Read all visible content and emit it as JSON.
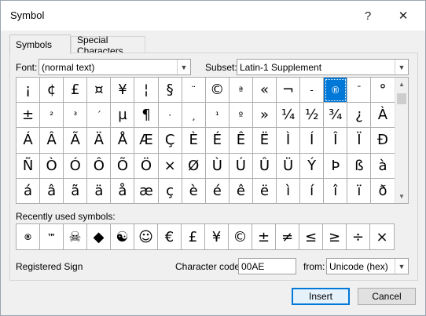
{
  "window": {
    "title": "Symbol",
    "help_label": "?",
    "close_label": "✕"
  },
  "tabs": [
    {
      "label": "Symbols",
      "active": true
    },
    {
      "label": "Special Characters",
      "active": false
    }
  ],
  "font": {
    "label": "Font:",
    "value": "(normal text)"
  },
  "subset": {
    "label": "Subset:",
    "value": "Latin-1 Supplement"
  },
  "symbol_grid": {
    "rows": [
      [
        "¡",
        "¢",
        "£",
        "¤",
        "¥",
        "¦",
        "§",
        "¨",
        "©",
        "ª",
        "«",
        "¬",
        "-",
        "®",
        "¯",
        "°"
      ],
      [
        "±",
        "²",
        "³",
        "´",
        "µ",
        "¶",
        "·",
        "¸",
        "¹",
        "º",
        "»",
        "¼",
        "½",
        "¾",
        "¿",
        "À"
      ],
      [
        "Á",
        "Â",
        "Ã",
        "Ä",
        "Å",
        "Æ",
        "Ç",
        "È",
        "É",
        "Ê",
        "Ë",
        "Ì",
        "Í",
        "Î",
        "Ï",
        "Đ"
      ],
      [
        "Ñ",
        "Ò",
        "Ó",
        "Ô",
        "Õ",
        "Ö",
        "×",
        "Ø",
        "Ù",
        "Ú",
        "Û",
        "Ü",
        "Ý",
        "Þ",
        "ß",
        "à"
      ],
      [
        "á",
        "â",
        "ã",
        "ä",
        "å",
        "æ",
        "ç",
        "è",
        "é",
        "ê",
        "ë",
        "ì",
        "í",
        "î",
        "ï",
        "ð"
      ]
    ],
    "selected": "®"
  },
  "recent": {
    "label": "Recently used symbols:",
    "symbols": [
      "®",
      "™",
      "☠",
      "◆",
      "☯",
      "☺",
      "€",
      "£",
      "¥",
      "©",
      "±",
      "≠",
      "≤",
      "≥",
      "÷",
      "×"
    ]
  },
  "status": {
    "name": "Registered Sign"
  },
  "character_code": {
    "label": "Character code:",
    "value": "00AE"
  },
  "from": {
    "label": "from:",
    "value": "Unicode (hex)"
  },
  "buttons": {
    "insert": "Insert",
    "cancel": "Cancel"
  },
  "colors": {
    "selection": "#0078d7",
    "dialog_bg": "#f0f0f0"
  }
}
